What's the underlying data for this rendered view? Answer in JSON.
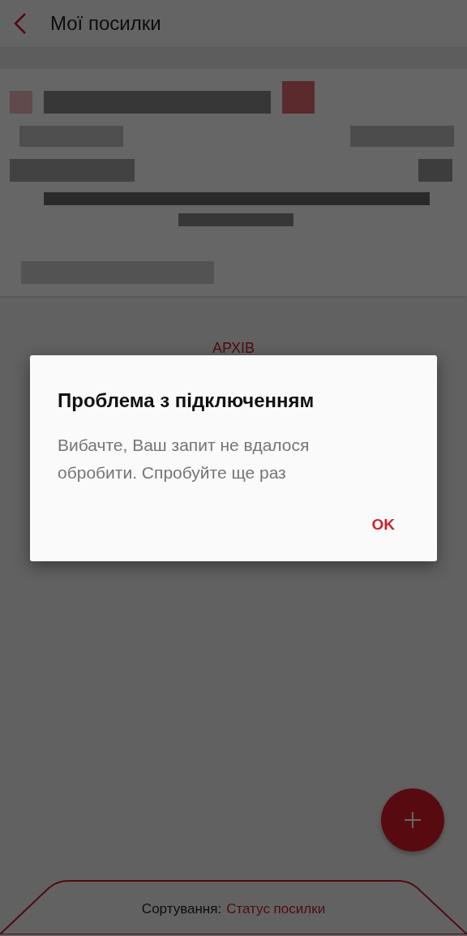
{
  "header": {
    "title": "Мої посилки"
  },
  "archive_link": "АРХІВ",
  "sort": {
    "label": "Сортування:",
    "value": "Статус посилки"
  },
  "dialog": {
    "title": "Проблема з підключенням",
    "message": "Вибачте, Ваш запит не вдалося обробити. Спробуйте ще раз",
    "buttons": [
      "OK"
    ]
  }
}
